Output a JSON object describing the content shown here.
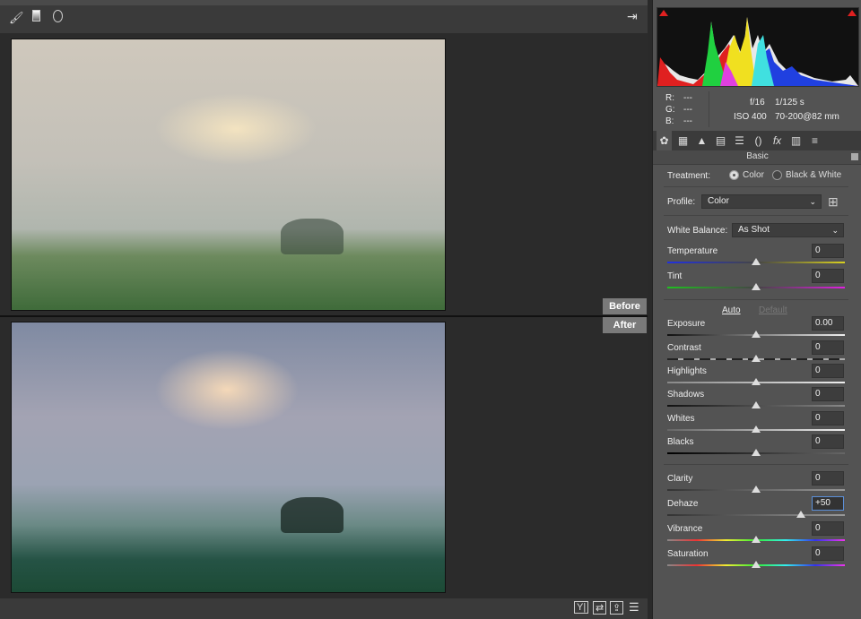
{
  "toolbar": {
    "icons": [
      "brush-icon",
      "gradient-icon",
      "radial-icon"
    ],
    "exit_icon": "exit-fullscreen-icon"
  },
  "preview": {
    "before_label": "Before",
    "after_label": "After"
  },
  "bottombar": {
    "icons": [
      "view-mode-icon",
      "swap-icon",
      "copy-settings-icon",
      "preview-settings-icon"
    ]
  },
  "info": {
    "r_label": "R:",
    "r": "---",
    "g_label": "G:",
    "g": "---",
    "b_label": "B:",
    "b": "---",
    "aperture": "f/16",
    "shutter": "1/125 s",
    "iso": "ISO 400",
    "lens": "70-200@82 mm"
  },
  "tabs": [
    "basic-icon",
    "tone-curve-icon",
    "detail-icon",
    "hsl-icon",
    "split-toning-icon",
    "lens-icon",
    "fx-icon",
    "calibration-icon",
    "presets-icon"
  ],
  "panel": {
    "title": "Basic",
    "treatment_label": "Treatment:",
    "treatment_color": "Color",
    "treatment_bw": "Black & White",
    "treatment_selected": "Color",
    "profile_label": "Profile:",
    "profile_value": "Color",
    "wb_label": "White Balance:",
    "wb_value": "As Shot",
    "auto": "Auto",
    "default": "Default"
  },
  "sliders": [
    {
      "label": "Temperature",
      "value": "0",
      "pos": 0.5
    },
    {
      "label": "Tint",
      "value": "0",
      "pos": 0.5
    },
    {
      "label": "Exposure",
      "value": "0.00",
      "pos": 0.5
    },
    {
      "label": "Contrast",
      "value": "0",
      "pos": 0.5
    },
    {
      "label": "Highlights",
      "value": "0",
      "pos": 0.5
    },
    {
      "label": "Shadows",
      "value": "0",
      "pos": 0.5
    },
    {
      "label": "Whites",
      "value": "0",
      "pos": 0.5
    },
    {
      "label": "Blacks",
      "value": "0",
      "pos": 0.5
    },
    {
      "label": "Clarity",
      "value": "0",
      "pos": 0.5
    },
    {
      "label": "Dehaze",
      "value": "+50",
      "pos": 0.75,
      "active": true
    },
    {
      "label": "Vibrance",
      "value": "0",
      "pos": 0.5
    },
    {
      "label": "Saturation",
      "value": "0",
      "pos": 0.5
    }
  ]
}
